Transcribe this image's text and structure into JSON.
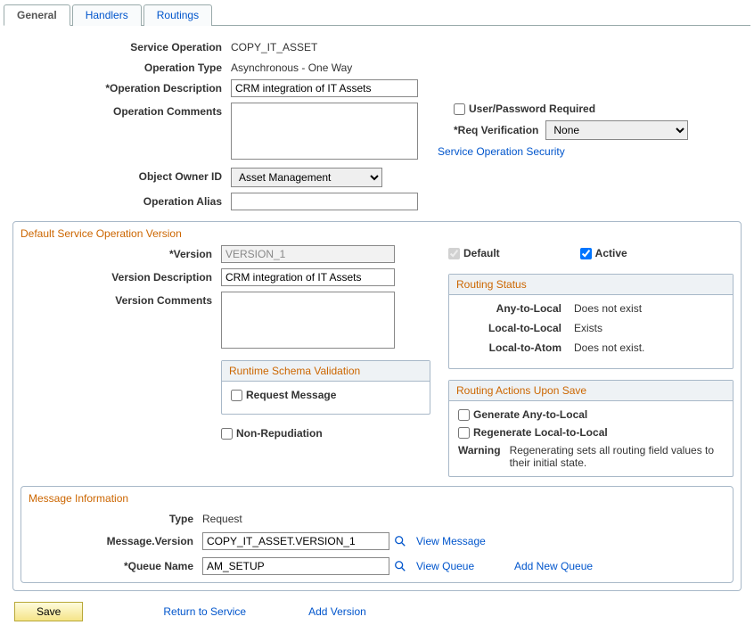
{
  "tabs": {
    "general": "General",
    "handlers": "Handlers",
    "routings": "Routings"
  },
  "labels": {
    "service_operation": "Service Operation",
    "operation_type": "Operation Type",
    "operation_description": "*Operation Description",
    "operation_comments": "Operation Comments",
    "object_owner_id": "Object Owner ID",
    "operation_alias": "Operation Alias",
    "user_password_required": "User/Password Required",
    "req_verification": "*Req Verification",
    "service_operation_security": "Service Operation Security",
    "version": "*Version",
    "version_description": "Version Description",
    "version_comments": "Version Comments",
    "default": "Default",
    "active": "Active",
    "routing_status": "Routing Status",
    "any_to_local": "Any-to-Local",
    "local_to_local": "Local-to-Local",
    "local_to_atom": "Local-to-Atom",
    "runtime_schema_validation": "Runtime Schema Validation",
    "request_message": "Request Message",
    "routing_actions": "Routing Actions Upon Save",
    "generate_any_to_local": "Generate Any-to-Local",
    "regenerate_local_to_local": "Regenerate Local-to-Local",
    "warning": "Warning",
    "non_repudiation": "Non-Repudiation",
    "message_information": "Message Information",
    "type": "Type",
    "message_version": "Message.Version",
    "queue_name": "*Queue Name",
    "view_message": "View Message",
    "view_queue": "View Queue",
    "add_new_queue": "Add New Queue",
    "save": "Save",
    "return_to_service": "Return to Service",
    "add_version": "Add Version",
    "default_service_operation_version": "Default Service Operation Version"
  },
  "values": {
    "service_operation": "COPY_IT_ASSET",
    "operation_type": "Asynchronous - One Way",
    "operation_description": "CRM integration of IT Assets",
    "operation_comments": "",
    "object_owner_id": "Asset Management",
    "operation_alias": "",
    "req_verification": "None",
    "version": "VERSION_1",
    "version_description": "CRM integration of IT Assets",
    "version_comments": "",
    "any_to_local": "Does not exist",
    "local_to_local": "Exists",
    "local_to_atom": "Does not exist.",
    "warning_text": "Regenerating sets all routing field values to their initial state.",
    "type": "Request",
    "message_version": "COPY_IT_ASSET.VERSION_1",
    "queue_name": "AM_SETUP"
  },
  "options": {
    "req_verification": [
      "None"
    ],
    "object_owner_id": [
      "Asset Management"
    ]
  },
  "checks": {
    "user_password_required": false,
    "default": true,
    "active": true,
    "request_message": false,
    "generate_any_to_local": false,
    "regenerate_local_to_local": false,
    "non_repudiation": false
  }
}
